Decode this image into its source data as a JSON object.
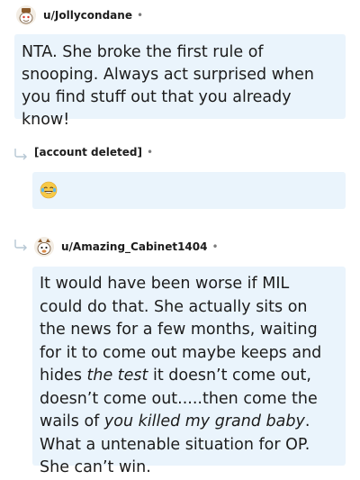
{
  "comments": [
    {
      "username": "u/Jollycondane",
      "separator": "•",
      "paragraph": "NTA. She broke the first rule of snooping. Always act surprised when you find stuff out that you already know!"
    },
    {
      "username": "[account deleted]",
      "separator": "•",
      "emoji": "laughing-tears-emoji"
    },
    {
      "username": "u/Amazing_Cabinet1404",
      "separator": "•",
      "segments": [
        {
          "text": "It would have been worse if MIL could do that. She actually sits on the news for a few months, waiting for it to come out maybe keeps and hides ",
          "italic": false
        },
        {
          "text": "the test",
          "italic": true
        },
        {
          "text": " it doesn’t come out, doesn’t come out.....then come the wails of ",
          "italic": false
        },
        {
          "text": "you killed my grand baby",
          "italic": true
        },
        {
          "text": ". What a untenable situation for OP. She can’t win.",
          "italic": false
        }
      ]
    }
  ],
  "colors": {
    "bubble": "#eaf4fc",
    "text": "#1c1c1c",
    "meta": "#7c7c7c"
  }
}
